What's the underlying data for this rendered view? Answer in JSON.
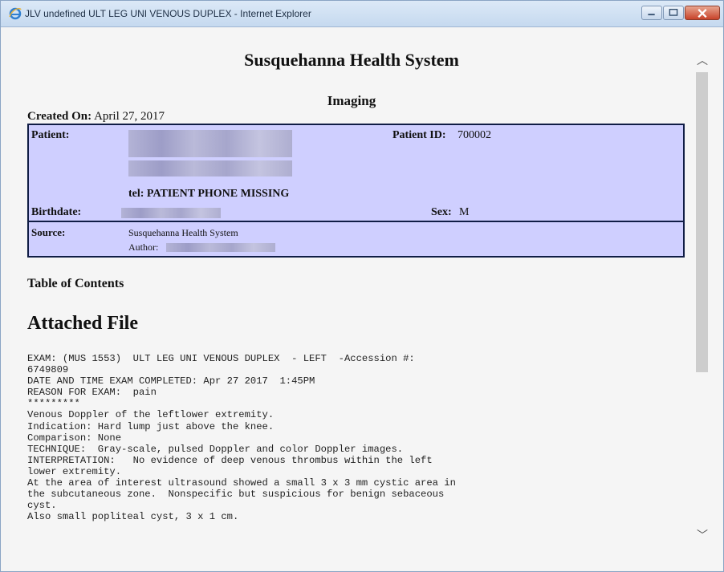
{
  "window": {
    "title": "JLV undefined ULT LEG UNI VENOUS DUPLEX - Internet Explorer",
    "icon": "internet-explorer-icon",
    "accent_color": "#c5d9ef"
  },
  "document": {
    "org_name": "Susquehanna Health System",
    "section": "Imaging",
    "created_label": "Created On:",
    "created_value": "April 27, 2017",
    "patient": {
      "patient_label": "Patient:",
      "patient_id_label": "Patient ID:",
      "patient_id_value": "700002",
      "phone_line": "tel: PATIENT PHONE MISSING",
      "birthdate_label": "Birthdate:",
      "sex_label": "Sex:",
      "sex_value": "M",
      "box_color": "#cfcfff"
    },
    "source": {
      "source_label": "Source:",
      "source_value": "Susquehanna Health System",
      "author_label": "Author:"
    },
    "toc_heading": "Table of Contents",
    "attached_heading": "Attached File",
    "report_lines": [
      "EXAM: (MUS 1553)  ULT LEG UNI VENOUS DUPLEX  - LEFT  -Accession #:",
      "6749809",
      "DATE AND TIME EXAM COMPLETED: Apr 27 2017  1:45PM",
      "REASON FOR EXAM:  pain",
      "*********",
      "Venous Doppler of the leftlower extremity.",
      "Indication: Hard lump just above the knee.",
      "Comparison: None",
      "TECHNIQUE:  Gray-scale, pulsed Doppler and color Doppler images.",
      "INTERPRETATION:   No evidence of deep venous thrombus within the left",
      "lower extremity.",
      "At the area of interest ultrasound showed a small 3 x 3 mm cystic area in",
      "the subcutaneous zone.  Nonspecific but suspicious for benign sebaceous",
      "cyst.",
      "Also small popliteal cyst, 3 x 1 cm."
    ]
  },
  "scrollbar": {
    "up_icon": "chevron-up-icon",
    "down_icon": "chevron-down-icon"
  }
}
